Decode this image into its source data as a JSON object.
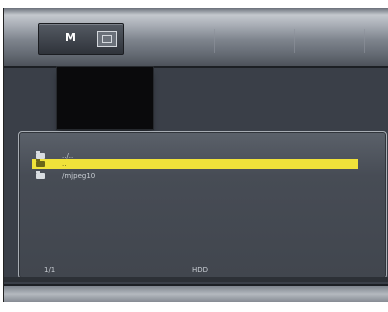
{
  "menu": {
    "active_tab": "M",
    "tabs": [
      "",
      "",
      "",
      ""
    ]
  },
  "browser": {
    "rows": [
      {
        "label": "../..",
        "selected": false
      },
      {
        "label": "..",
        "selected": true
      },
      {
        "label": "/mjpeg10",
        "selected": false
      }
    ],
    "page_indicator": "1/1",
    "device": "HDD"
  },
  "colors": {
    "highlight": "#f0e23a",
    "panel": "#474c55"
  }
}
